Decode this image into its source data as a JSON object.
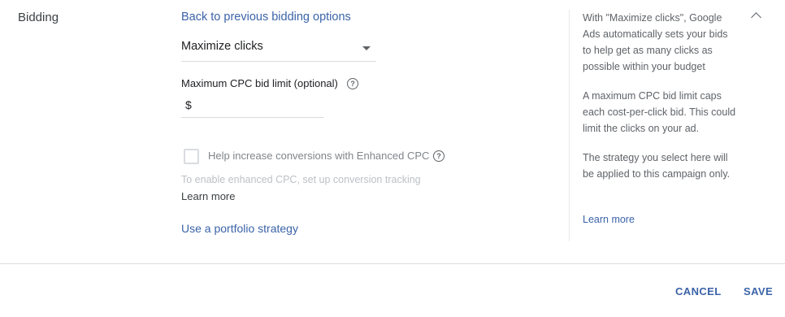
{
  "section": {
    "label": "Bidding"
  },
  "bidding": {
    "back_link": "Back to previous bidding options",
    "strategy_selected": "Maximize clicks",
    "cpc_limit_label": "Maximum CPC bid limit (optional)",
    "currency_symbol": "$",
    "cpc_limit_value": "",
    "ecpc_label": "Help increase conversions with Enhanced CPC",
    "ecpc_checked": false,
    "ecpc_hint": "To enable enhanced CPC, set up conversion tracking",
    "learn_more": "Learn more",
    "portfolio_link": "Use a portfolio strategy"
  },
  "help_panel": {
    "paragraphs": [
      "With \"Maximize clicks\", Google Ads automatically sets your bids to help get as many clicks as possible within your budget",
      "A maximum CPC bid limit caps each cost-per-click bid. This could limit the clicks on your ad.",
      "The strategy you select here will be applied to this campaign only."
    ],
    "learn_more": "Learn more"
  },
  "footer": {
    "cancel": "CANCEL",
    "save": "SAVE"
  },
  "icons": {
    "help": "help-circle-icon",
    "dropdown": "caret-down-icon",
    "collapse": "chevron-up-icon"
  },
  "colors": {
    "link": "#3b63a8",
    "divider": "#dadce0"
  }
}
